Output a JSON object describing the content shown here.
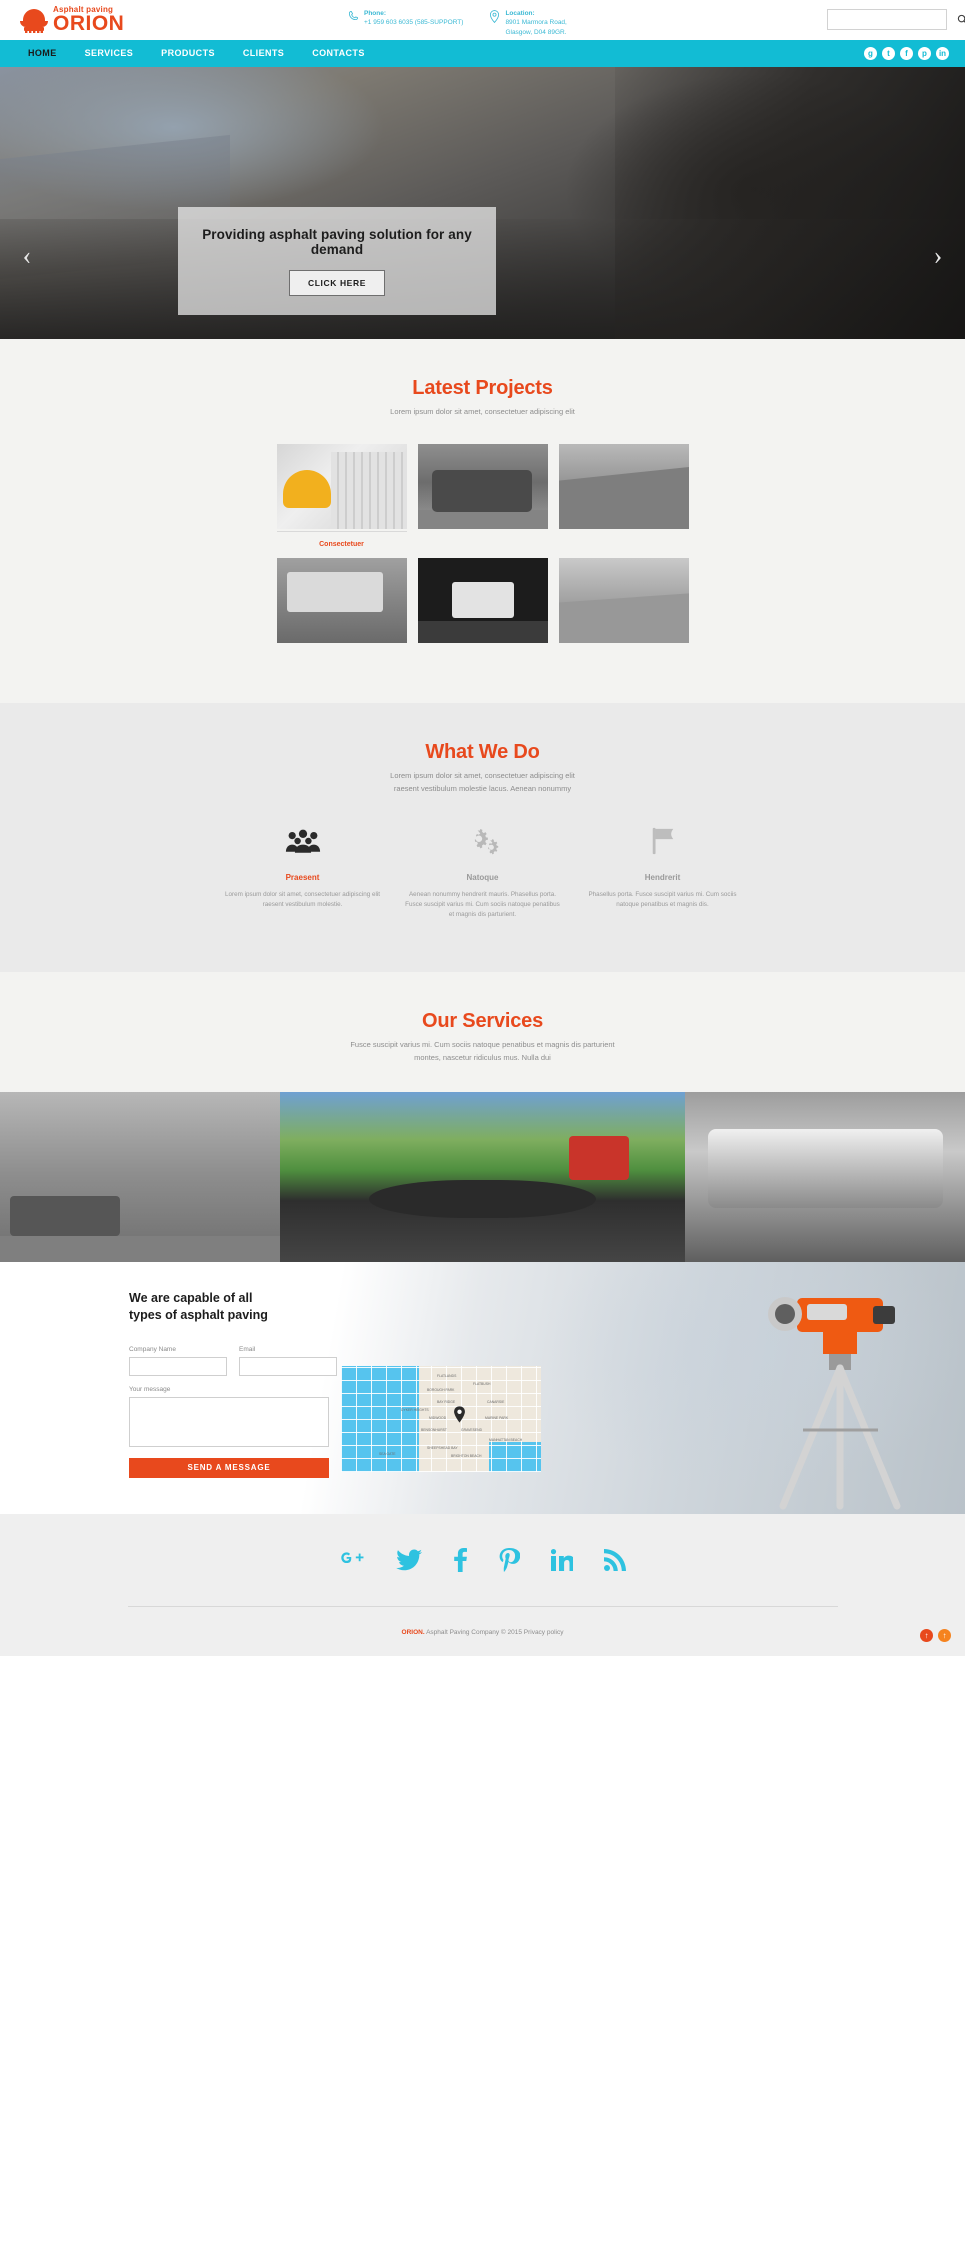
{
  "header": {
    "logo": {
      "sub": "Asphalt paving",
      "main": "ORION",
      "icon": "hardhat-icon"
    },
    "phone": {
      "label": "Phone:",
      "value": "+1 959 603 6035 (585-SUPPORT)",
      "icon": "phone-icon"
    },
    "location": {
      "label": "Location:",
      "line1": "8901 Marmora Road,",
      "line2": "Glasgow, D04 89GR.",
      "icon": "map-marker-icon"
    },
    "search": {
      "value": "",
      "placeholder": "",
      "button_icon": "search-icon"
    }
  },
  "nav": {
    "items": [
      {
        "label": "HOME",
        "active": true
      },
      {
        "label": "SERVICES",
        "active": false
      },
      {
        "label": "PRODUCTS",
        "active": false
      },
      {
        "label": "CLIENTS",
        "active": false
      },
      {
        "label": "CONTACTS",
        "active": false
      }
    ],
    "social": [
      {
        "name": "google-plus-icon",
        "glyph": "g"
      },
      {
        "name": "twitter-icon",
        "glyph": "t"
      },
      {
        "name": "facebook-icon",
        "glyph": "f"
      },
      {
        "name": "pinterest-icon",
        "glyph": "p"
      },
      {
        "name": "linkedin-icon",
        "glyph": "in"
      }
    ]
  },
  "hero": {
    "title": "Providing asphalt paving solution for any demand",
    "button": "CLICK HERE",
    "prev_icon": "chevron-left-icon",
    "next_icon": "chevron-right-icon"
  },
  "projects": {
    "title": "Latest Projects",
    "subtitle": "Lorem ipsum dolor sit amet, consectetuer adipiscing elit",
    "items": [
      {
        "caption": "Consectetuer"
      },
      {
        "caption": ""
      },
      {
        "caption": ""
      },
      {
        "caption": ""
      },
      {
        "caption": ""
      },
      {
        "caption": ""
      }
    ]
  },
  "what_we_do": {
    "title": "What We Do",
    "subtitle_line1": "Lorem ipsum dolor sit amet, consectetuer adipiscing elit",
    "subtitle_line2": "raesent vestibulum molestie lacus. Aenean nonummy",
    "columns": [
      {
        "icon": "people-group-icon",
        "name": "Praesent",
        "highlight": true,
        "text": "Lorem ipsum dolor sit amet, consectetuer adipiscing elit raesent vestibulum molestie."
      },
      {
        "icon": "gears-icon",
        "name": "Natoque",
        "highlight": false,
        "text": "Aenean nonummy hendrerit mauris. Phasellus porta. Fusce suscipit varius mi. Cum sociis natoque penatibus et magnis dis parturient."
      },
      {
        "icon": "flag-icon",
        "name": "Hendrerit",
        "highlight": false,
        "text": "Phasellus porta. Fusce suscipit varius mi. Cum sociis natoque penatibus et magnis dis."
      }
    ]
  },
  "services": {
    "title": "Our Services",
    "subtitle_line1": "Fusce suscipit varius mi. Cum sociis natoque penatibus et magnis dis parturient",
    "subtitle_line2": "montes, nascetur ridiculus mus. Nulla dui",
    "tiles": [
      {
        "name": "service-tile-roller"
      },
      {
        "name": "service-tile-paving-crew"
      },
      {
        "name": "service-tile-drum"
      }
    ]
  },
  "contact": {
    "title_line1": "We are capable of all",
    "title_line2": "types of asphalt paving",
    "fields": [
      {
        "label": "Company Name",
        "value": "",
        "placeholder": ""
      },
      {
        "label": "Email",
        "value": "",
        "placeholder": ""
      }
    ],
    "message": {
      "label": "Your message",
      "value": "",
      "placeholder": ""
    },
    "submit": "SEND A MESSAGE",
    "map": {
      "pin_icon": "map-pin-icon",
      "labels": [
        "FLATBUSH",
        "BOROUGH PARK",
        "MIDWOOD",
        "BAY RIDGE",
        "DYKER HEIGHTS",
        "BENSONHURST",
        "GRAVESEND",
        "SHEEPSHEAD BAY",
        "BRIGHTON BEACH",
        "FLATLANDS",
        "CANARSIE",
        "MARINE PARK",
        "MANHATTAN BEACH",
        "SEA GATE"
      ]
    }
  },
  "footer": {
    "social": [
      {
        "name": "google-plus-icon",
        "glyph": "g+"
      },
      {
        "name": "twitter-icon",
        "glyph": "twitter"
      },
      {
        "name": "facebook-icon",
        "glyph": "f"
      },
      {
        "name": "pinterest-icon",
        "glyph": "p"
      },
      {
        "name": "linkedin-icon",
        "glyph": "in"
      },
      {
        "name": "rss-icon",
        "glyph": "rss"
      }
    ],
    "brand": "ORION.",
    "copyright": " Asphalt Paving Company © 2015 ",
    "privacy": "Privacy policy",
    "to_top_icons": [
      "arrow-up-icon",
      "arrow-up-icon"
    ]
  },
  "colors": {
    "accent": "#e8491d",
    "nav": "#12bcd4",
    "social": "#2ec2e0",
    "light_bg": "#f3f3f1",
    "grey_bg": "#eaeaea"
  }
}
